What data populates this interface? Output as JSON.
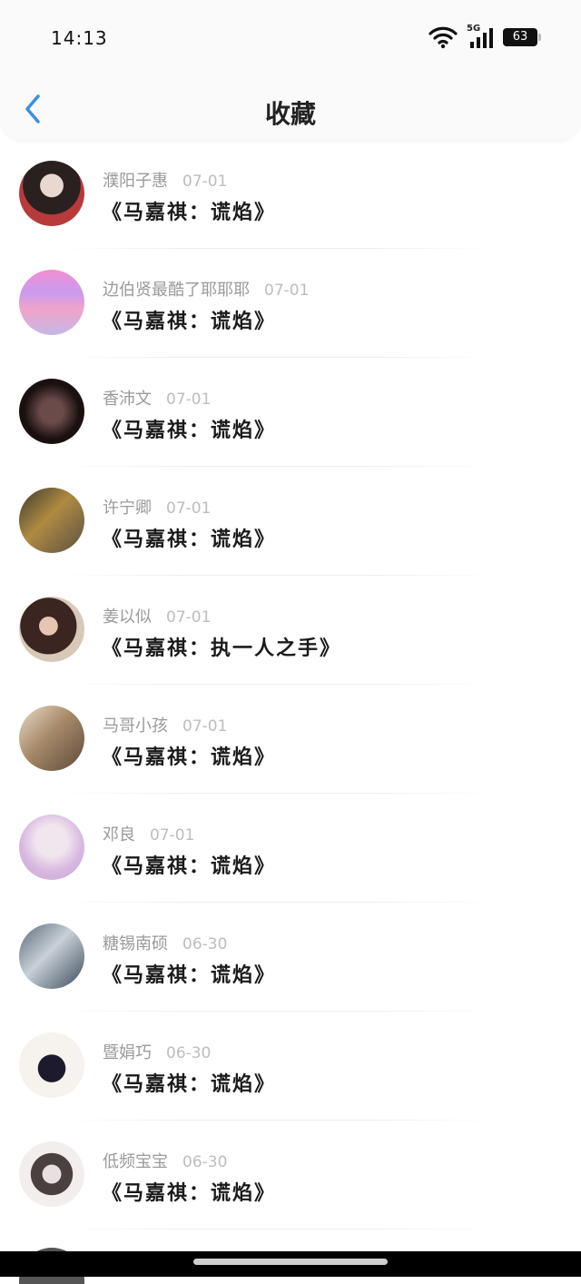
{
  "status_bar": {
    "time": "14:13",
    "network": "5G",
    "battery": "63"
  },
  "header": {
    "back_icon": "chevron-left-icon",
    "title": "收藏"
  },
  "colors": {
    "accent": "#3a8ee6",
    "header_bg": "#fafafa",
    "name_text": "#9a9a9a",
    "date_text": "#bdbdbd"
  },
  "favorites": [
    {
      "name": "濮阳子惠",
      "date": "07-01",
      "work": "《马嘉祺：谎焰》"
    },
    {
      "name": "边伯贤最酷了耶耶耶",
      "date": "07-01",
      "work": "《马嘉祺：谎焰》"
    },
    {
      "name": "香沛文",
      "date": "07-01",
      "work": "《马嘉祺：谎焰》"
    },
    {
      "name": "许宁卿",
      "date": "07-01",
      "work": "《马嘉祺：谎焰》"
    },
    {
      "name": "姜以似",
      "date": "07-01",
      "work": "《马嘉祺：执一人之手》"
    },
    {
      "name": "马哥小孩",
      "date": "07-01",
      "work": "《马嘉祺：谎焰》"
    },
    {
      "name": "邓良",
      "date": "07-01",
      "work": "《马嘉祺：谎焰》"
    },
    {
      "name": "糖锡南硕",
      "date": "06-30",
      "work": "《马嘉祺：谎焰》"
    },
    {
      "name": "暨娟巧",
      "date": "06-30",
      "work": "《马嘉祺：谎焰》"
    },
    {
      "name": "低频宝宝",
      "date": "06-30",
      "work": "《马嘉祺：谎焰》"
    }
  ]
}
